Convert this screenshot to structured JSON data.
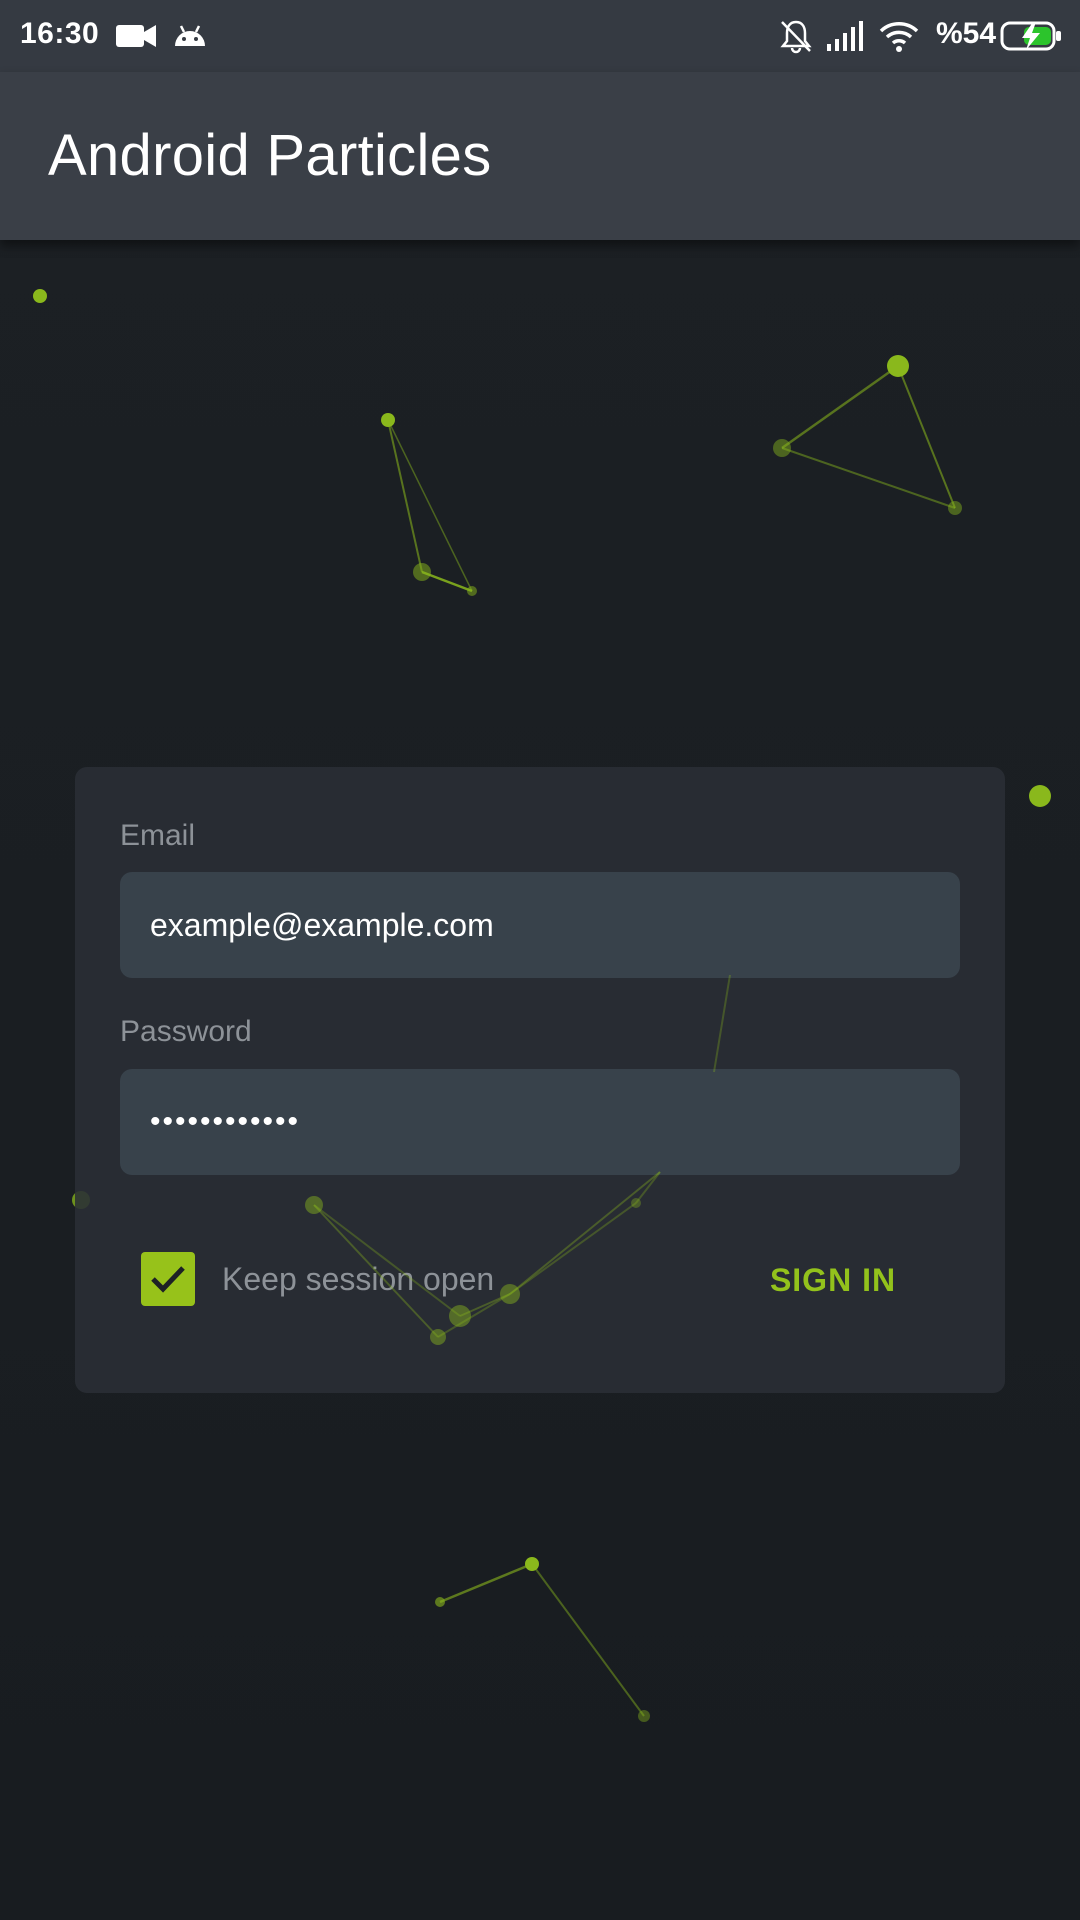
{
  "status_bar": {
    "time": "16:30",
    "battery_text": "%54",
    "icons": [
      "video-camera-icon",
      "android-icon",
      "notifications-muted-icon",
      "signal-icon",
      "wifi-icon",
      "battery-charging-icon"
    ]
  },
  "app_bar": {
    "title": "Android Particles"
  },
  "login": {
    "email_label": "Email",
    "email_value": "example@example.com",
    "password_label": "Password",
    "password_value": "••••••••••••",
    "keep_session_label": "Keep session open",
    "keep_session_checked": true,
    "sign_in_label": "SIGN IN"
  },
  "colors": {
    "accent": "#93c21c",
    "background": "#1b1f23",
    "app_bar": "#3a3f47",
    "status_bar": "#353a42",
    "card": "#2a2f35",
    "field": "#38424b",
    "label": "#8d9298"
  }
}
